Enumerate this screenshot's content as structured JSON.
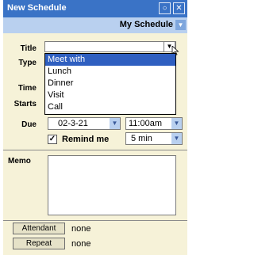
{
  "window": {
    "title": "New Schedule",
    "minimize_glyph": "○",
    "close_glyph": "✕"
  },
  "header": {
    "schedule_label": "My Schedule"
  },
  "form": {
    "title_label": "Title",
    "type_label": "Type",
    "time_label": "Time",
    "starts_label": "Starts",
    "due_label": "Due",
    "due_date": "02-3-21",
    "due_time": "11:00am",
    "remind_label": "Remind me",
    "remind_checked": true,
    "remind_value": "5 min",
    "memo_label": "Memo"
  },
  "dropdown": {
    "options": [
      "Meet with",
      "Lunch",
      "Dinner",
      "Visit",
      "Call"
    ],
    "selected_index": 0
  },
  "footer": {
    "attendant_button": "Attendant",
    "attendant_value": "none",
    "repeat_button": "Repeat",
    "repeat_value": "none"
  }
}
